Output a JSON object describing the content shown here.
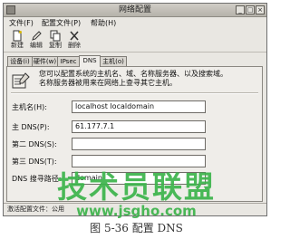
{
  "window": {
    "title": "网络配置"
  },
  "menu": {
    "items": [
      "文件(F)",
      "配置文件(P)",
      "帮助(H)"
    ]
  },
  "toolbar": {
    "buttons": [
      {
        "label": "新建",
        "icon": "new-icon"
      },
      {
        "label": "编辑",
        "icon": "edit-icon"
      },
      {
        "label": "复制",
        "icon": "copy-icon"
      },
      {
        "label": "删除",
        "icon": "delete-icon"
      }
    ]
  },
  "tabs": [
    "设备(i)",
    "硬件(w)",
    "IPsec",
    "DNS",
    "主机(o)"
  ],
  "active_tab": "DNS",
  "dns": {
    "description_line1": "您可以配置系统的主机名、域、名称服务器、以及搜索域。",
    "description_line2": "名称服务器被用来在网络上查寻其它主机。",
    "fields": [
      {
        "label": "主机名(H):",
        "value": "localhost localdomain"
      },
      {
        "label": "主 DNS(P):",
        "value": "61.177.7.1"
      },
      {
        "label": "第二 DNS(S):",
        "value": ""
      },
      {
        "label": "第三 DNS(T):",
        "value": ""
      },
      {
        "label": "DNS 搜寻路径:",
        "value": "domain"
      }
    ]
  },
  "status": {
    "text": "激活配置文件：公用"
  },
  "caption": "图 5-36 配置 DNS",
  "watermark": {
    "title": "技术员联盟",
    "url": "www.jsgho.com"
  },
  "colors": {
    "watermark": "#3cb44b",
    "window_bg": "#e9e7e2"
  }
}
